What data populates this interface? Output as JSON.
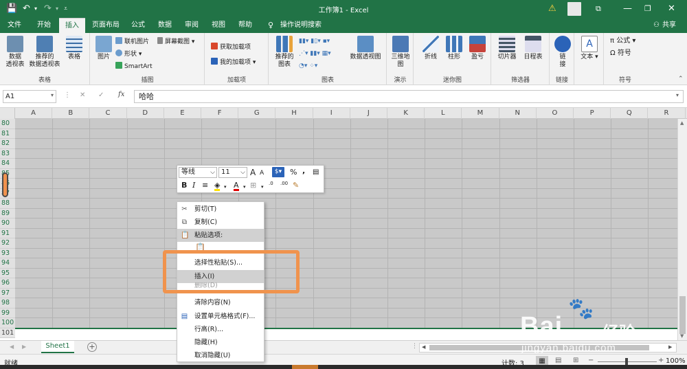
{
  "titlebar": {
    "title": "工作簿1 - Excel",
    "save_icon": "save-icon",
    "undo_icon": "undo-icon",
    "redo_icon": "redo-icon",
    "customize_icon": "customize-icon",
    "warning_icon": "warning-icon",
    "restore_icon": "restore-icon",
    "colors": {
      "brand": "#217346"
    }
  },
  "ribbon_tabs": {
    "items": [
      "文件",
      "开始",
      "插入",
      "页面布局",
      "公式",
      "数据",
      "审阅",
      "视图",
      "帮助"
    ],
    "active": "插入",
    "tell_me": "操作说明搜索",
    "share": "共享"
  },
  "ribbon": {
    "tables": {
      "pivot": "数据\n透视表",
      "recommended_pivot": "推荐的\n数据透视表",
      "table": "表格",
      "label": "表格"
    },
    "illustrations": {
      "picture": "图片",
      "online_picture": "联机图片",
      "shapes": "形状",
      "smartart": "SmartArt",
      "screenshot": "屏幕截图",
      "label": "插图"
    },
    "addins": {
      "get": "获取加载项",
      "my": "我的加载项",
      "label": "加载项"
    },
    "charts": {
      "recommended": "推荐的\n图表",
      "pivotchart": "数据透视图",
      "label": "图表"
    },
    "tours": {
      "map3d": "三维地\n图",
      "label": "演示"
    },
    "sparklines": {
      "line": "折线",
      "column": "柱形",
      "winloss": "盈亏",
      "label": "迷你图"
    },
    "filters": {
      "slicer": "切片器",
      "timeline": "日程表",
      "label": "筛选器"
    },
    "links": {
      "link": "链\n接",
      "label": "链接"
    },
    "text": {
      "text": "文本",
      "label": ""
    },
    "symbols": {
      "equation": "公式",
      "symbol": "符号",
      "label": "符号"
    }
  },
  "formula_bar": {
    "name_box": "A1",
    "cancel": "✕",
    "enter": "✓",
    "fx": "fx",
    "value": "哈哈"
  },
  "grid": {
    "columns": [
      "A",
      "B",
      "C",
      "D",
      "E",
      "F",
      "G",
      "H",
      "I",
      "J",
      "K",
      "L",
      "M",
      "N",
      "O",
      "P",
      "Q",
      "R"
    ],
    "rows": [
      "80",
      "81",
      "82",
      "83",
      "84",
      "85",
      "86",
      "87",
      "88",
      "89",
      "90",
      "91",
      "92",
      "93",
      "94",
      "95",
      "96",
      "97",
      "98",
      "99",
      "100",
      "101"
    ]
  },
  "mini_toolbar": {
    "font": "等线",
    "size": "11",
    "grow": "A",
    "shrink": "A",
    "percent": "%",
    "comma": "9",
    "bold": "B",
    "italic": "I",
    "font_color": "A",
    "dec_inc": ".0",
    "dec_dec": ".00"
  },
  "context_menu": {
    "items": [
      {
        "label": "剪切(T)",
        "icon": "scissors-icon"
      },
      {
        "label": "复制(C)",
        "icon": "copy-icon"
      },
      {
        "label": "粘贴选项:",
        "icon": "paste-icon"
      },
      {
        "label": "",
        "icon": "paste-option-icon"
      },
      {
        "label": "选择性粘贴(S)...",
        "icon": ""
      },
      {
        "label": "插入(I)",
        "icon": ""
      },
      {
        "label": "删除(D)",
        "icon": ""
      },
      {
        "label": "清除内容(N)",
        "icon": ""
      },
      {
        "label": "设置单元格格式(F)...",
        "icon": "format-cells-icon"
      },
      {
        "label": "行高(R)...",
        "icon": ""
      },
      {
        "label": "隐藏(H)",
        "icon": ""
      },
      {
        "label": "取消隐藏(U)",
        "icon": ""
      }
    ],
    "highlight_color": "#f0934d"
  },
  "sheets": {
    "items": [
      "Sheet1"
    ],
    "add": "+"
  },
  "status": {
    "left": "就绪",
    "count": "计数: 3",
    "zoom": "100%",
    "minus": "−",
    "plus": "+"
  },
  "watermark": {
    "brand": "Bai",
    "brand2": "经验",
    "url": "jingyan.baidu.com"
  }
}
